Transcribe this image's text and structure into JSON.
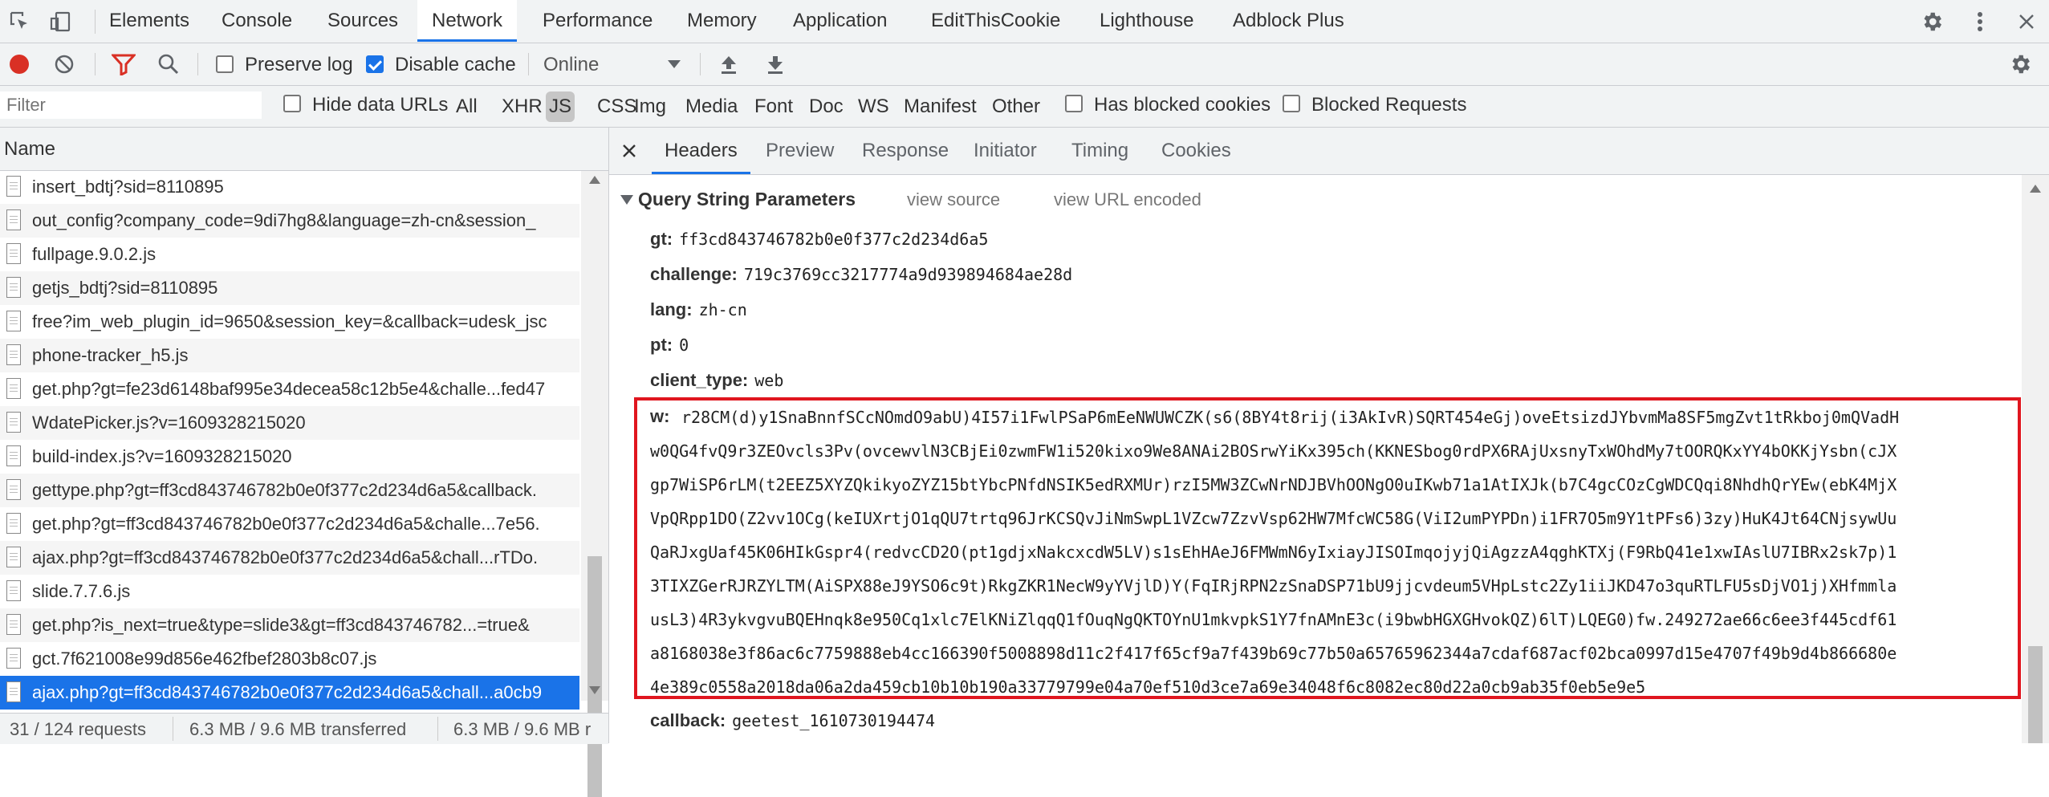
{
  "main_tabs": [
    "Elements",
    "Console",
    "Sources",
    "Network",
    "Performance",
    "Memory",
    "Application",
    "EditThisCookie",
    "Lighthouse",
    "Adblock Plus"
  ],
  "active_main_tab": "Network",
  "toolbar": {
    "preserve_log": "Preserve log",
    "disable_cache": "Disable cache",
    "throttle": "Online"
  },
  "filter": {
    "placeholder": "Filter",
    "hide_data_urls": "Hide data URLs",
    "types": [
      "All",
      "XHR",
      "JS",
      "CSS",
      "Img",
      "Media",
      "Font",
      "Doc",
      "WS",
      "Manifest",
      "Other"
    ],
    "active_type": "JS",
    "has_blocked_cookies": "Has blocked cookies",
    "blocked_requests": "Blocked Requests"
  },
  "request_list": {
    "header": "Name",
    "rows": [
      "insert_bdtj?sid=8110895",
      "out_config?company_code=9di7hg8&language=zh-cn&session_",
      "fullpage.9.0.2.js",
      "getjs_bdtj?sid=8110895",
      "free?im_web_plugin_id=9650&session_key=&callback=udesk_jsc",
      "phone-tracker_h5.js",
      "get.php?gt=fe23d6148baf995e34decea58c12b5e4&challe...fed47",
      "WdatePicker.js?v=1609328215020",
      "build-index.js?v=1609328215020",
      "gettype.php?gt=ff3cd843746782b0e0f377c2d234d6a5&callback.",
      "get.php?gt=ff3cd843746782b0e0f377c2d234d6a5&challe...7e56.",
      "ajax.php?gt=ff3cd843746782b0e0f377c2d234d6a5&chall...rTDo.",
      "slide.7.7.6.js",
      "get.php?is_next=true&type=slide3&gt=ff3cd843746782...=true&",
      "gct.7f621008e99d856e462fbef2803b8c07.js",
      "ajax.php?gt=ff3cd843746782b0e0f377c2d234d6a5&chall...a0cb9"
    ],
    "selected_index": 15
  },
  "status_bar": {
    "requests": "31 / 124 requests",
    "transferred": "6.3 MB / 9.6 MB transferred",
    "resources": "6.3 MB / 9.6 MB r"
  },
  "detail_tabs": [
    "Headers",
    "Preview",
    "Response",
    "Initiator",
    "Timing",
    "Cookies"
  ],
  "active_detail_tab": "Headers",
  "query_section": {
    "title": "Query String Parameters",
    "view_source": "view source",
    "view_url_encoded": "view URL encoded",
    "params": [
      {
        "key": "gt:",
        "value": "ff3cd843746782b0e0f377c2d234d6a5"
      },
      {
        "key": "challenge:",
        "value": "719c3769cc3217774a9d939894684ae28d"
      },
      {
        "key": "lang:",
        "value": "zh-cn"
      },
      {
        "key": "pt:",
        "value": "0"
      },
      {
        "key": "client_type:",
        "value": "web"
      }
    ],
    "w_key": "w:",
    "w_lines": [
      "r28CM(d)y1SnaBnnfSCcNOmdO9abU)4I57i1FwlPSaP6mEeNWUWCZK(s6(8BY4t8rij(i3AkIvR)SQRT454eGj)oveEtsizdJYbvmMa8SF5mgZvt1tRkboj0mQVadH",
      "w0QG4fvQ9r3ZEOvcls3Pv(ovcewvlN3CBjEi0zwmFW1i520kixo9We8ANAi2BOSrwYiKx395ch(KKNESbog0rdPX6RAjUxsnyTxWOhdMy7tOORQKxYY4bOKKjYsbn(cJX",
      "gp7WiSP6rLM(t2EEZ5XYZQkikyoZYZ15btYbcPNfdNSIK5edRXMUr)rzI5MW3ZCwNrNDJBVhOONgO0uIKwb71a1AtIXJk(b7C4gcCOzCgWDCQqi8NhdhQrYEw(ebK4MjX",
      "VpQRpp1DO(Z2vv1OCg(keIUXrtjO1qQU7trtq96JrKCSQvJiNmSwpL1VZcw7ZzvVsp62HW7MfcWC58G(ViI2umPYPDn)i1FR7O5m9Y1tPFs6)3zy)HuK4Jt64CNjsywUu",
      "QaRJxgUaf45K06HIkGspr4(redvcCD2O(pt1gdjxNakcxcdW5LV)s1sEhHAeJ6FMWmN6yIxiayJISOImqojyjQiAgzzA4qghKTXj(F9RbQ41e1xwIAslU7IBRx2sk7p)1",
      "3TIXZGerRJRZYLTM(AiSPX88eJ9YSO6c9t)RkgZKR1NecW9yYVjlD)Y(FqIRjRPN2zSnaDSP71bU9jjcvdeum5VHpLstc2Zy1iiJKD47o3quRTLFU5sDjVO1j)XHfmmla",
      "usL3)4R3ykvgvuBQEHnqk8e950Cq1xlc7ElKNiZlqqQ1fOuqNgQKTOYnU1mkvpkS1Y7fnAMnE3c(i9bwbHGXGHvokQZ)6lT)LQEG0)fw.249272ae66c6ee3f445cdf61",
      "a8168038e3f86ac6c7759888eb4cc166390f5008898d11c2f417f65cf9a7f439b69c77b50a65765962344a7cdaf687acf02bca0997d15e4707f49b9d4b866680e",
      "4e389c0558a2018da06a2da459cb10b10b190a33779799e04a70ef510d3ce7a69e34048f6c8082ec80d22a0cb9ab35f0eb5e9e5"
    ],
    "callback_key": "callback:",
    "callback_value": "geetest_1610730194474"
  },
  "colors": {
    "record": "#d93025",
    "filter_active": "#d93025",
    "accent": "#1a73e8",
    "highlight_box": "#e0161f"
  },
  "icons": [
    "inspect-icon",
    "device-toolbar-icon",
    "settings-icon",
    "more-vert-icon",
    "close-icon",
    "record-icon",
    "clear-icon",
    "filter-icon",
    "search-icon",
    "upload-icon",
    "download-icon",
    "throttle-dropdown-icon"
  ]
}
